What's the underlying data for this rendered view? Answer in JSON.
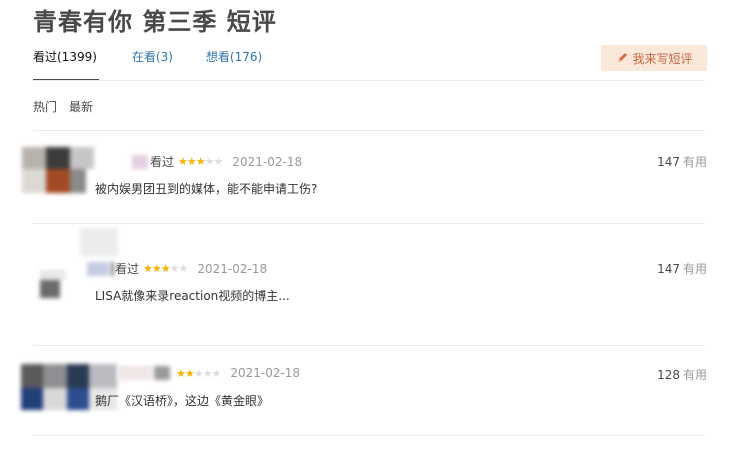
{
  "title": "青春有你 第三季 短评",
  "tabs": [
    {
      "label": "看过(1399)",
      "active": true
    },
    {
      "label": "在看(3)",
      "active": false
    },
    {
      "label": "想看(176)",
      "active": false
    }
  ],
  "write_button": {
    "label": "我来写短评",
    "icon": "pencil-icon"
  },
  "sort": [
    {
      "label": "热门"
    },
    {
      "label": "最新"
    }
  ],
  "comments": [
    {
      "status": "看过",
      "rating": 3,
      "date": "2021-02-18",
      "votes": "147",
      "useful_label": "有用",
      "content": "被内娱男团丑到的媒体，能不能申请工伤?"
    },
    {
      "status": "看过",
      "rating": 3,
      "date": "2021-02-18",
      "votes": "147",
      "useful_label": "有用",
      "content": "LISA就像来录reaction视频的博主..."
    },
    {
      "status": "",
      "rating": 2,
      "date": "2021-02-18",
      "votes": "128",
      "useful_label": "有用",
      "content": "鹅厂《汉语桥》，这边《黄金眼》"
    }
  ],
  "colors": {
    "link": "#3377aa",
    "star": "#f4b400",
    "button_bg": "#fae9da",
    "button_text": "#ca6445"
  }
}
